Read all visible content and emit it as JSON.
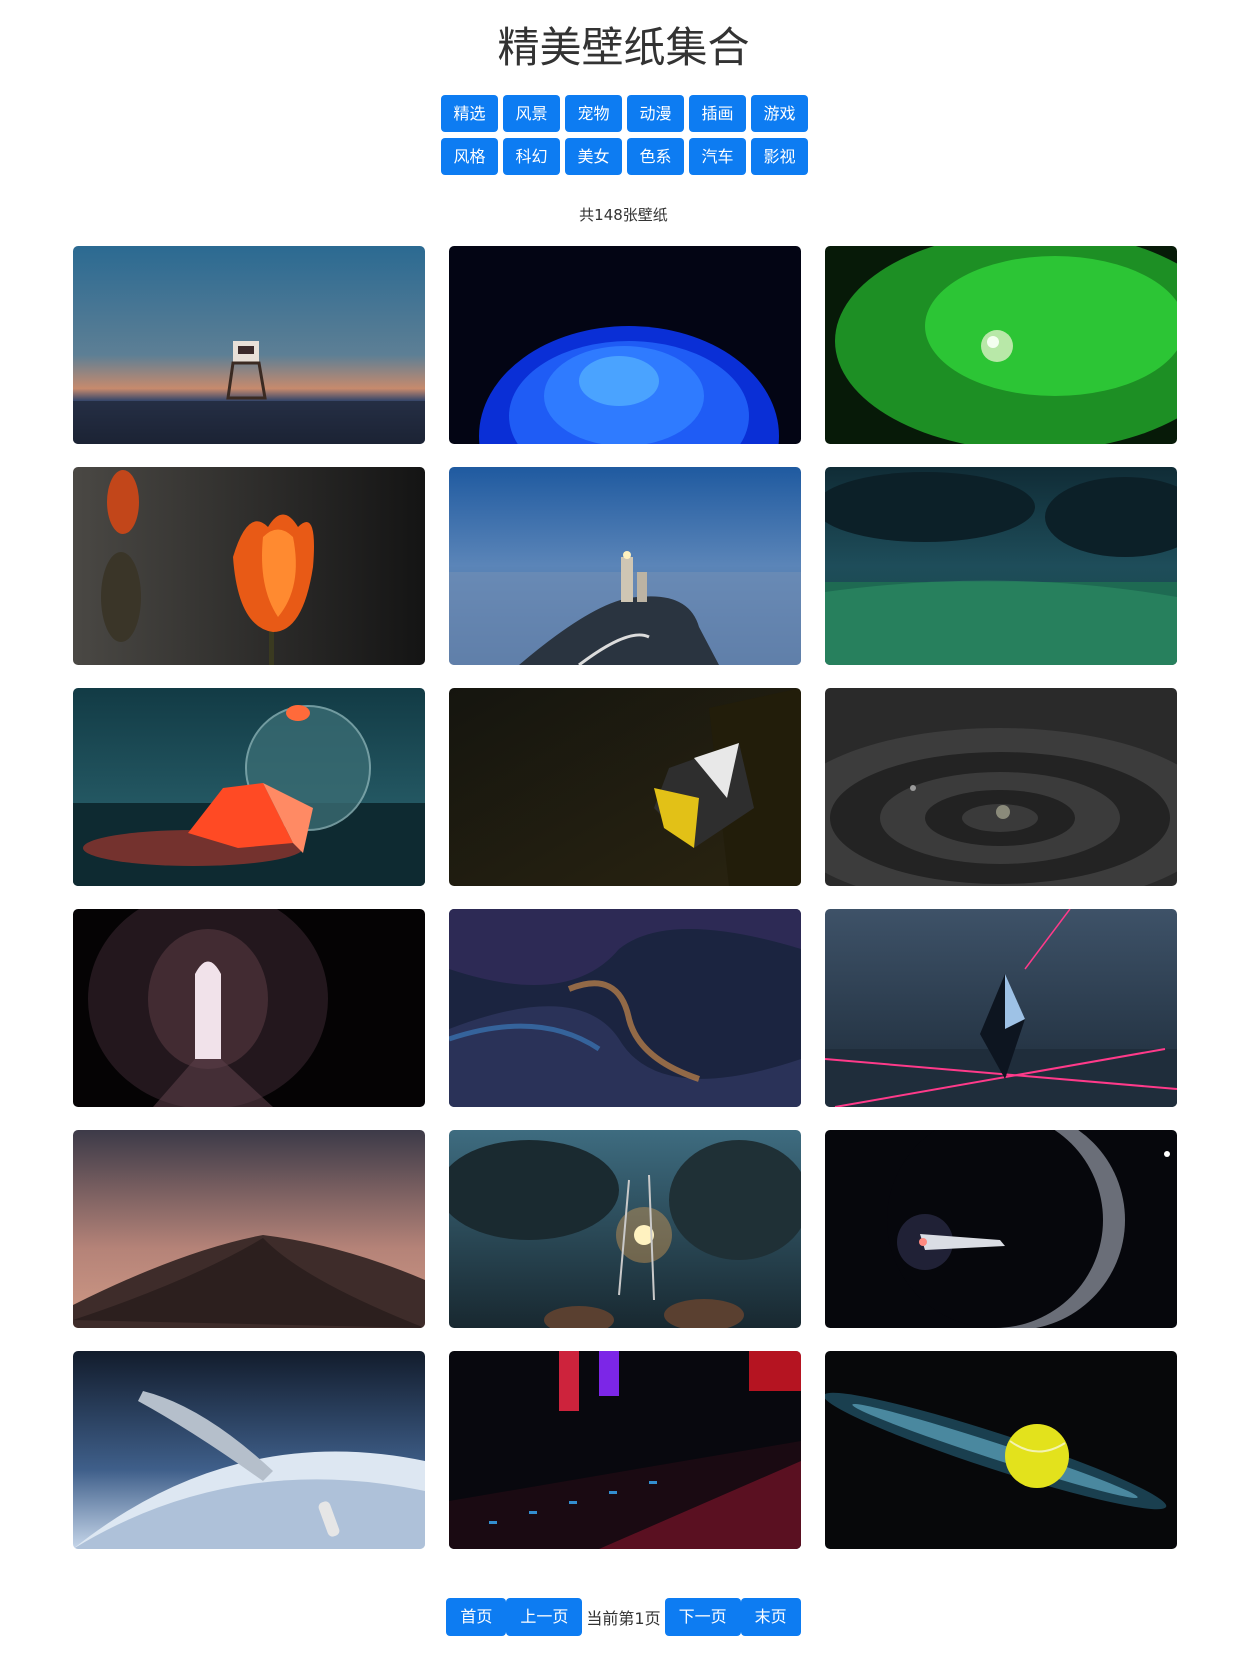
{
  "header": {
    "title": "精美壁纸集合"
  },
  "categories": [
    "精选",
    "风景",
    "宠物",
    "动漫",
    "插画",
    "游戏",
    "风格",
    "科幻",
    "美女",
    "色系",
    "汽车",
    "影视"
  ],
  "summary": {
    "count_text": "共148张壁纸"
  },
  "colors": {
    "accent": "#0d7cf2"
  },
  "pagination": {
    "first": "首页",
    "prev": "上一页",
    "status": "当前第1页",
    "next": "下一页",
    "last": "末页"
  }
}
